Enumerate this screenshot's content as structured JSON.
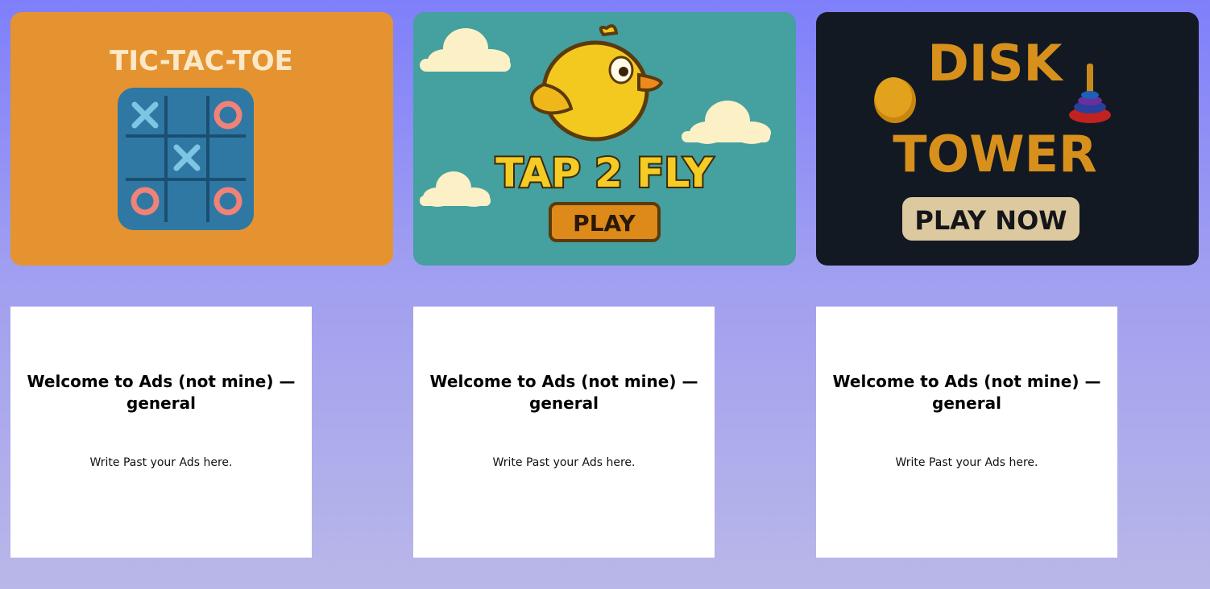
{
  "games": [
    {
      "title": "TIC-TAC-TOE",
      "board": [
        "X",
        "",
        "O",
        "",
        "X",
        "",
        "O",
        "",
        "O"
      ],
      "colors": {
        "background": "#e59331",
        "board": "#2f78a3",
        "x": "#7ec4e3",
        "o": "#f08277",
        "title": "#fbe8c7"
      }
    },
    {
      "title": "TAP 2 FLY",
      "button_label": "PLAY",
      "colors": {
        "background": "#45a0a0",
        "bird": "#f3c91f",
        "title": "#f5cb25",
        "button": "#dd8a1a"
      }
    },
    {
      "title_line1": "DISK",
      "title_line2": "TOWER",
      "button_label": "PLAY NOW",
      "colors": {
        "background": "#121923",
        "title": "#d8901c",
        "button": "#dcc9a0"
      }
    }
  ],
  "ads": [
    {
      "title": "Welcome to Ads (not mine) — general",
      "text": "Write Past your Ads here."
    },
    {
      "title": "Welcome to Ads (not mine) — general",
      "text": "Write Past your Ads here."
    },
    {
      "title": "Welcome to Ads (not mine) — general",
      "text": "Write Past your Ads here."
    }
  ]
}
